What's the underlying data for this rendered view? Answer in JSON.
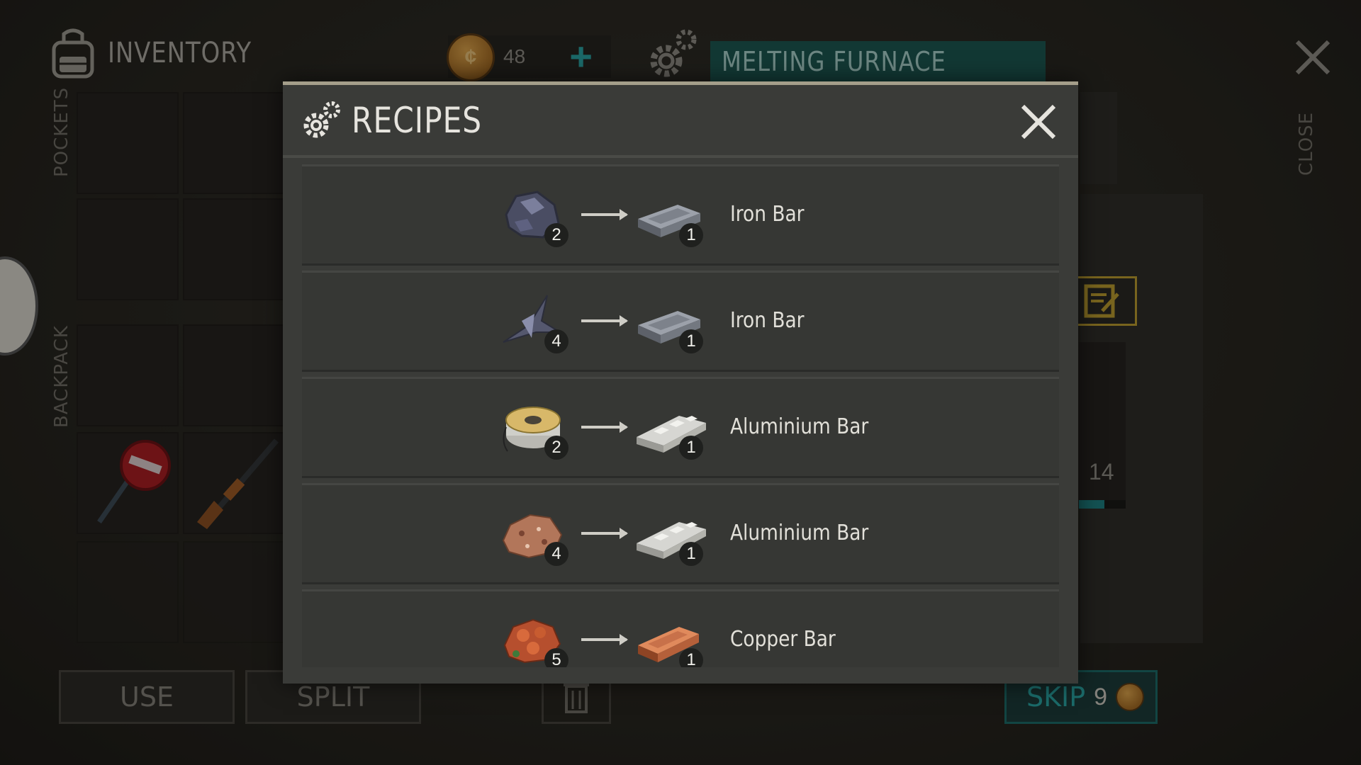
{
  "inventory": {
    "title": "INVENTORY",
    "pockets_label": "POCKETS",
    "backpack_label": "BACKPACK"
  },
  "currency": {
    "amount": "48",
    "plus_label": "+"
  },
  "station": {
    "title": "MELTING FURNACE",
    "close_label": "CLOSE",
    "slot_count": "14",
    "slot_progress": 0.55
  },
  "actions": {
    "use_label": "USE",
    "split_label": "SPLIT",
    "skip_label": "SKIP",
    "skip_cost": "9"
  },
  "modal": {
    "title": "RECIPES",
    "recipes": [
      {
        "input_icon": "iron-ore-icon",
        "input_count": "2",
        "output_icon": "iron-bar-icon",
        "output_count": "1",
        "name": "Iron Bar"
      },
      {
        "input_icon": "scrap-metal-icon",
        "input_count": "4",
        "output_icon": "iron-bar-icon",
        "output_count": "1",
        "name": "Iron Bar"
      },
      {
        "input_icon": "wire-spool-icon",
        "input_count": "2",
        "output_icon": "aluminium-bar-icon",
        "output_count": "1",
        "name": "Aluminium Bar"
      },
      {
        "input_icon": "bauxite-ore-icon",
        "input_count": "4",
        "output_icon": "aluminium-bar-icon",
        "output_count": "1",
        "name": "Aluminium Bar"
      },
      {
        "input_icon": "copper-ore-icon",
        "input_count": "5",
        "output_icon": "copper-bar-icon",
        "output_count": "1",
        "name": "Copper Bar"
      }
    ]
  },
  "colors": {
    "accent_teal": "#1d5650",
    "modal_bg": "#3a3b38",
    "gold": "#b99a2e"
  }
}
